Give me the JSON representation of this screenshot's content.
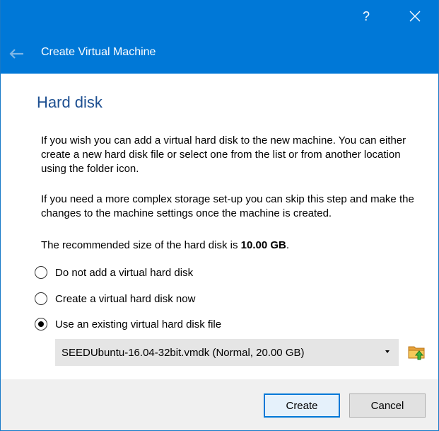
{
  "titlebar": {
    "help_glyph": "?",
    "title": "Create Virtual Machine",
    "background_color": "#0078d7",
    "back_icon": "back-arrow-icon",
    "close_icon": "close-icon"
  },
  "page": {
    "heading": "Hard disk",
    "heading_color": "#1d4f91",
    "paragraphs": [
      "If you wish you can add a virtual hard disk to the new machine. You can either create a new hard disk file or select one from the list or from another location using the folder icon.",
      "If you need a more complex storage set-up you can skip this step and make the changes to the machine settings once the machine is created."
    ],
    "recommended_prefix": "The recommended size of the hard disk is ",
    "recommended_size": "10.00 GB",
    "recommended_suffix": "."
  },
  "options": [
    {
      "label": "Do not add a virtual hard disk",
      "checked": false
    },
    {
      "label": "Create a virtual hard disk now",
      "checked": false
    },
    {
      "label": "Use an existing virtual hard disk file",
      "checked": true
    }
  ],
  "disk_select": {
    "value": "SEEDUbuntu-16.04-32bit.vmdk (Normal, 20.00 GB)",
    "folder_icon": "folder-open-icon"
  },
  "footer": {
    "create_label": "Create",
    "cancel_label": "Cancel"
  }
}
